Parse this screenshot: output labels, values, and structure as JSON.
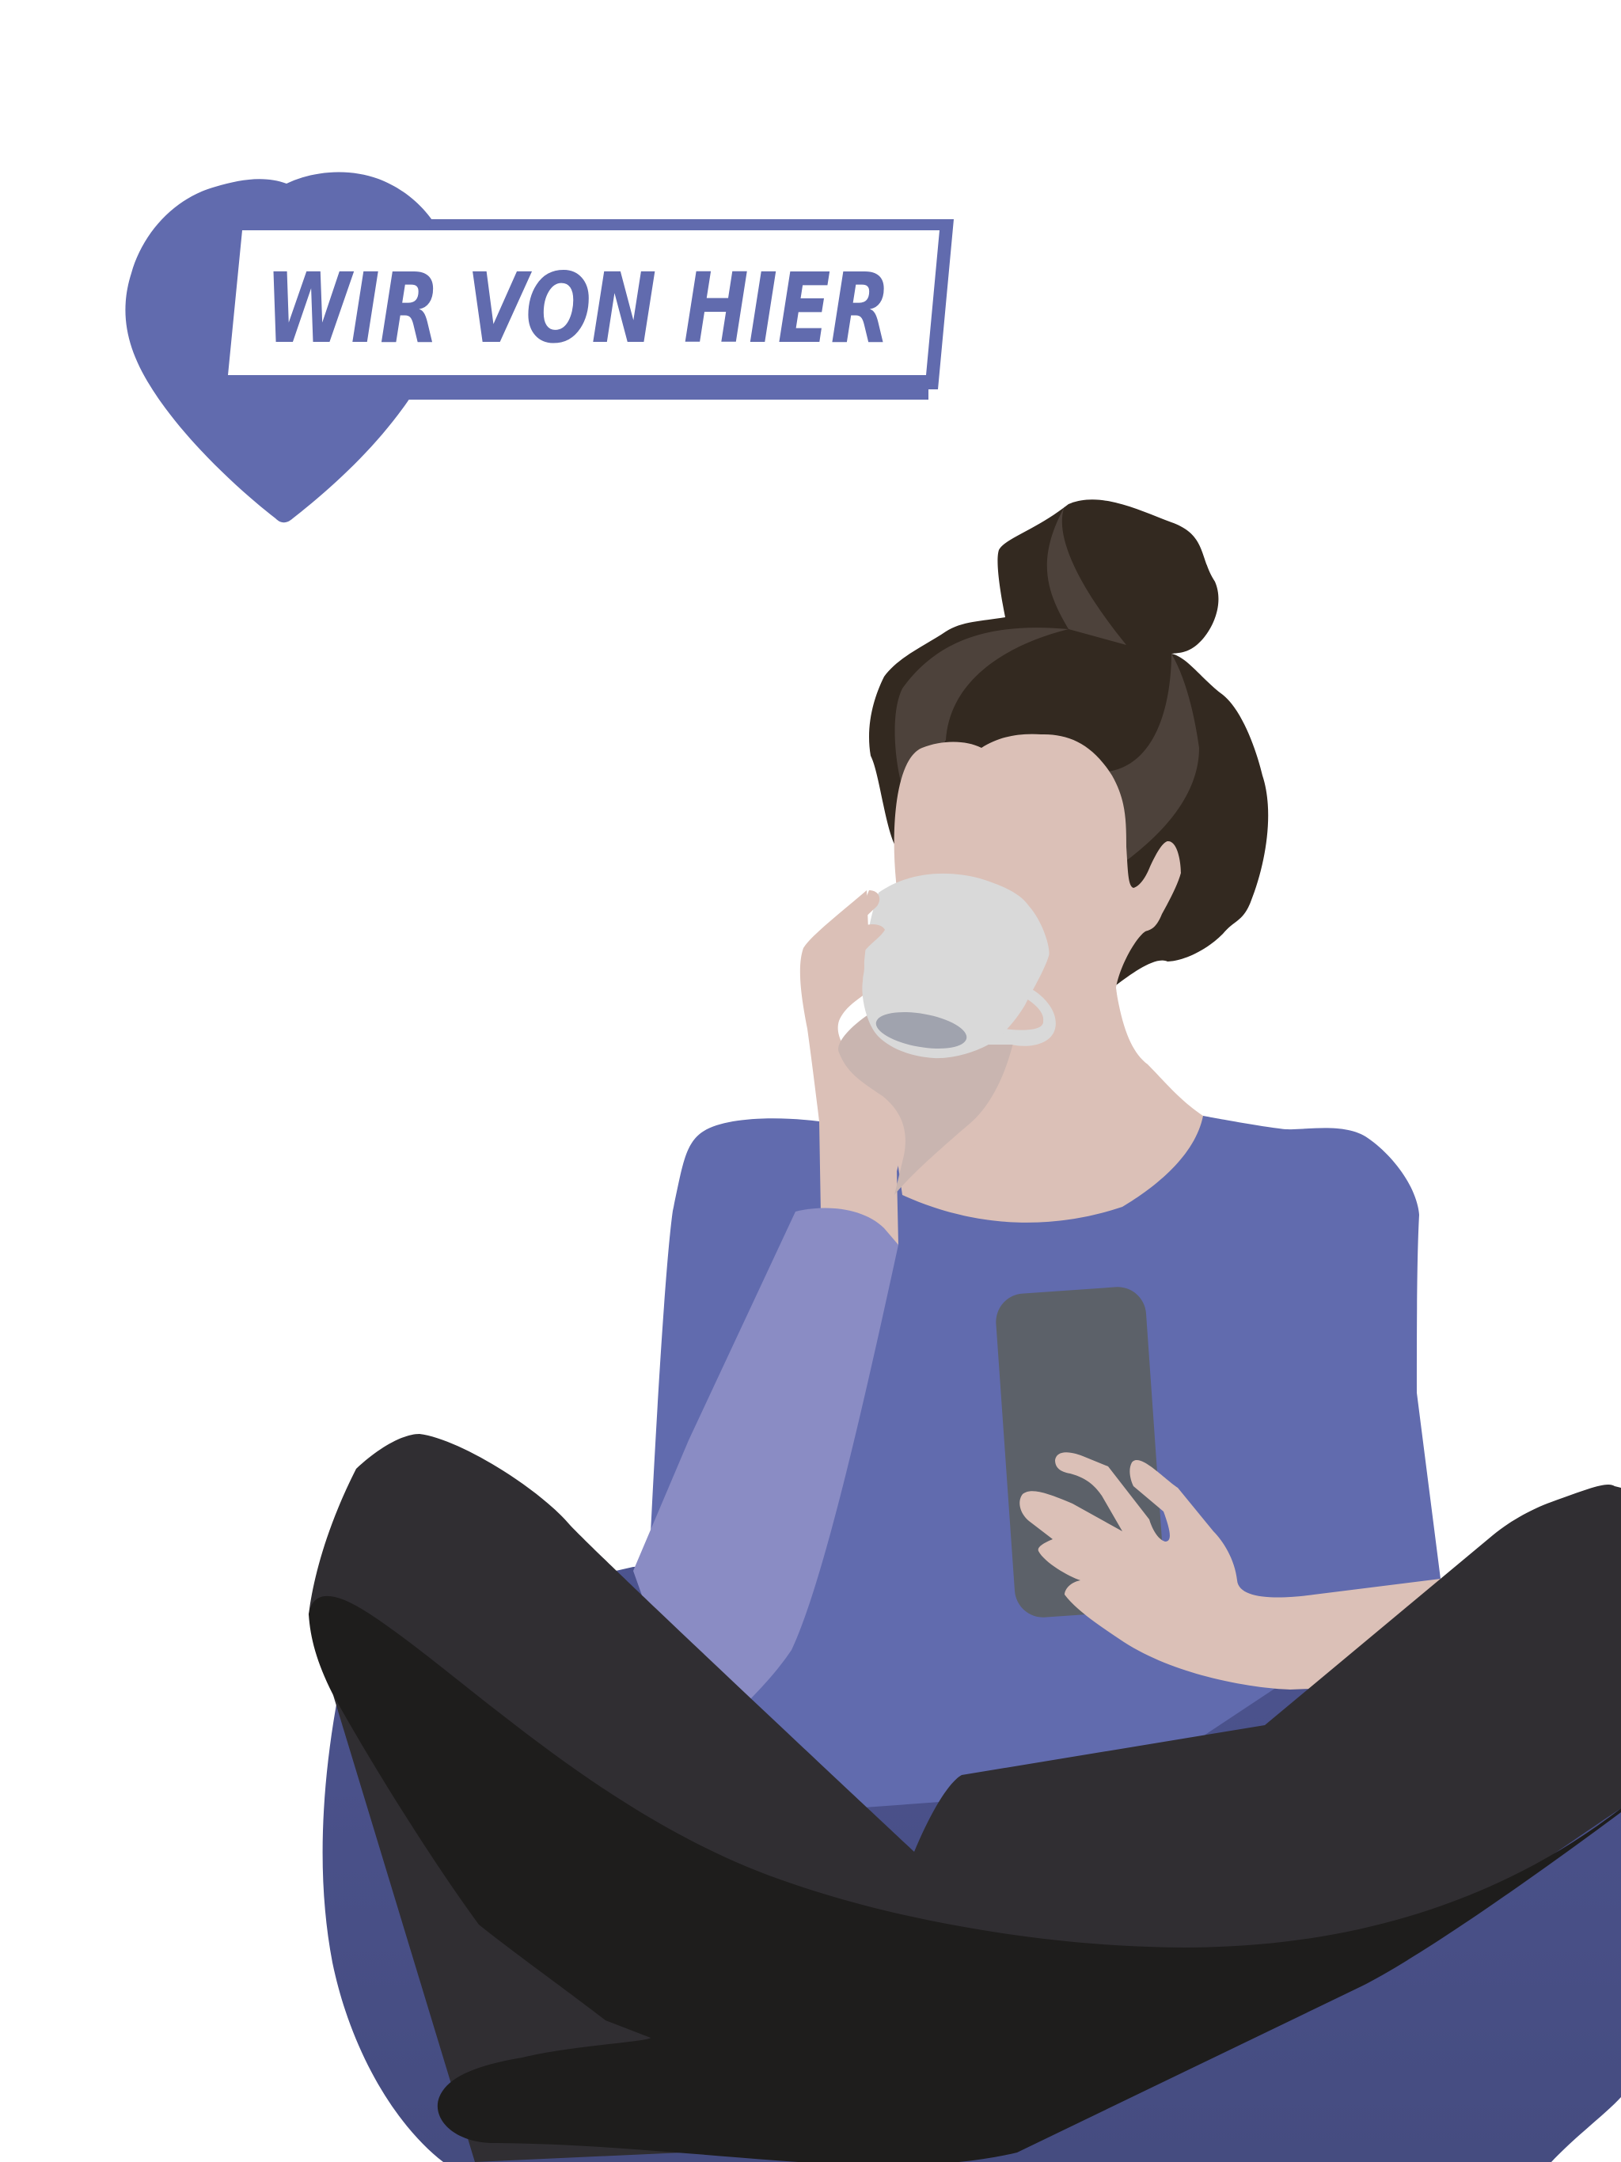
{
  "logo": {
    "text": "WIR VON HIER",
    "icon": "heart-icon"
  },
  "colors": {
    "brand": "#616bae",
    "sweater_light": "#8a8cc4",
    "skin": "#dbc0b7",
    "hair_dark": "#332920",
    "hair_highlight": "#4d423b",
    "cup": "#d9d9d9",
    "phone": "#5c6169",
    "pants": "#302e32",
    "pants_shadow": "#1e1d1c",
    "beanbag": "#474e83",
    "background": "#ffffff"
  }
}
